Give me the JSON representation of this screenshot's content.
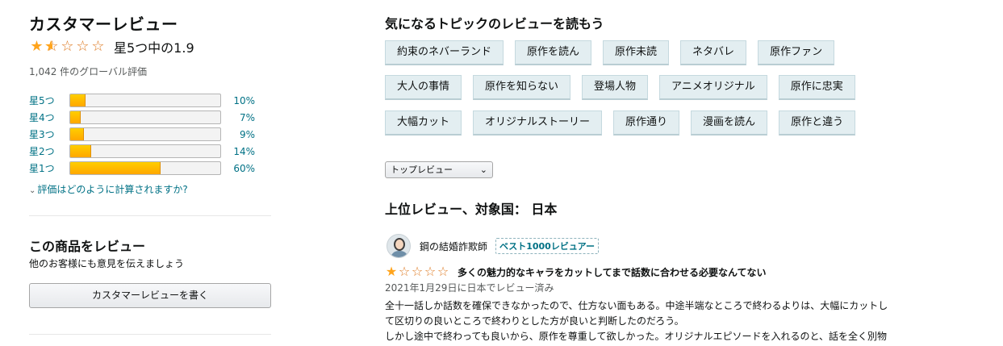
{
  "summary": {
    "title": "カスタマーレビュー",
    "rating_text": "星5つ中の1.9",
    "rating_value": 1.9,
    "global_ratings": "1,042 件のグローバル評価",
    "histogram": [
      {
        "label": "星5つ",
        "percent": "10%",
        "value": 10
      },
      {
        "label": "星4つ",
        "percent": "7%",
        "value": 7
      },
      {
        "label": "星3つ",
        "percent": "9%",
        "value": 9
      },
      {
        "label": "星2つ",
        "percent": "14%",
        "value": 14
      },
      {
        "label": "星1つ",
        "percent": "60%",
        "value": 60
      }
    ],
    "how_calculated": "評価はどのように計算されますか?"
  },
  "write_review": {
    "title": "この商品をレビュー",
    "subtitle": "他のお客様にも意見を伝えましょう",
    "button": "カスタマーレビューを書く"
  },
  "topics": {
    "title": "気になるトピックのレビューを読もう",
    "rows": [
      [
        "約束のネバーランド",
        "原作を読ん",
        "原作未読",
        "ネタバレ",
        "原作ファン"
      ],
      [
        "大人の事情",
        "原作を知らない",
        "登場人物",
        "アニメオリジナル",
        "原作に忠実"
      ],
      [
        "大幅カット",
        "オリジナルストーリー",
        "原作通り",
        "漫画を読ん",
        "原作と違う"
      ]
    ]
  },
  "sort": {
    "selected": "トップレビュー"
  },
  "reviews_header": "上位レビュー、対象国： 日本",
  "review": {
    "reviewer": "鋼の結婚詐欺師",
    "badge": "ベスト1000レビュアー",
    "rating": 1,
    "title": "多くの魅力的なキャラをカットしてまで話数に合わせる必要なんてない",
    "date": "2021年1月29日に日本でレビュー済み",
    "body_lines": [
      "全十一話しか話数を確保できなかったので、仕方ない面もある。中途半端なところで終わるよりは、大幅にカットし",
      "て区切りの良いところで終わりとした方が良いと判断したのだろう。",
      "しかし途中で終わっても良いから、原作を尊重して欲しかった。オリジナルエピソードを入れるのと、話を全く別物"
    ]
  },
  "colors": {
    "link": "#007185",
    "star": "#ffa41c",
    "topic_bg": "#e3eef1"
  }
}
